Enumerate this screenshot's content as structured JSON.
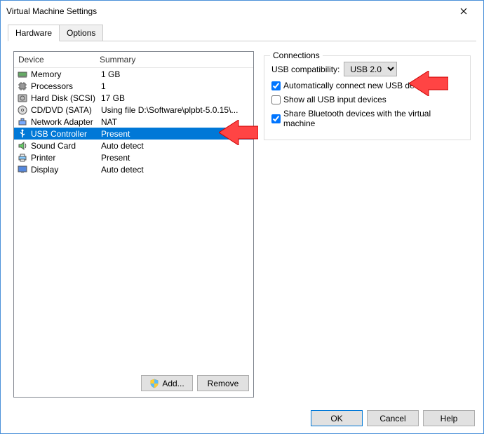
{
  "window": {
    "title": "Virtual Machine Settings"
  },
  "tabs": {
    "hardware": "Hardware",
    "options": "Options"
  },
  "headers": {
    "device": "Device",
    "summary": "Summary"
  },
  "devices": [
    {
      "icon": "memory",
      "name": "Memory",
      "summary": "1 GB"
    },
    {
      "icon": "cpu",
      "name": "Processors",
      "summary": "1"
    },
    {
      "icon": "disk",
      "name": "Hard Disk (SCSI)",
      "summary": "17 GB"
    },
    {
      "icon": "cd",
      "name": "CD/DVD (SATA)",
      "summary": "Using file D:\\Software\\plpbt-5.0.15\\..."
    },
    {
      "icon": "net",
      "name": "Network Adapter",
      "summary": "NAT"
    },
    {
      "icon": "usb",
      "name": "USB Controller",
      "summary": "Present"
    },
    {
      "icon": "sound",
      "name": "Sound Card",
      "summary": "Auto detect"
    },
    {
      "icon": "printer",
      "name": "Printer",
      "summary": "Present"
    },
    {
      "icon": "display",
      "name": "Display",
      "summary": "Auto detect"
    }
  ],
  "selectedIndex": 5,
  "buttons": {
    "add": "Add...",
    "remove": "Remove",
    "ok": "OK",
    "cancel": "Cancel",
    "help": "Help"
  },
  "connections": {
    "title": "Connections",
    "compatLabel": "USB compatibility:",
    "compatValue": "USB 2.0",
    "autoConnect": "Automatically connect new USB devices",
    "showAll": "Show all USB input devices",
    "shareBT": "Share Bluetooth devices with the virtual machine",
    "autoConnectChecked": true,
    "showAllChecked": false,
    "shareBTChecked": true
  }
}
